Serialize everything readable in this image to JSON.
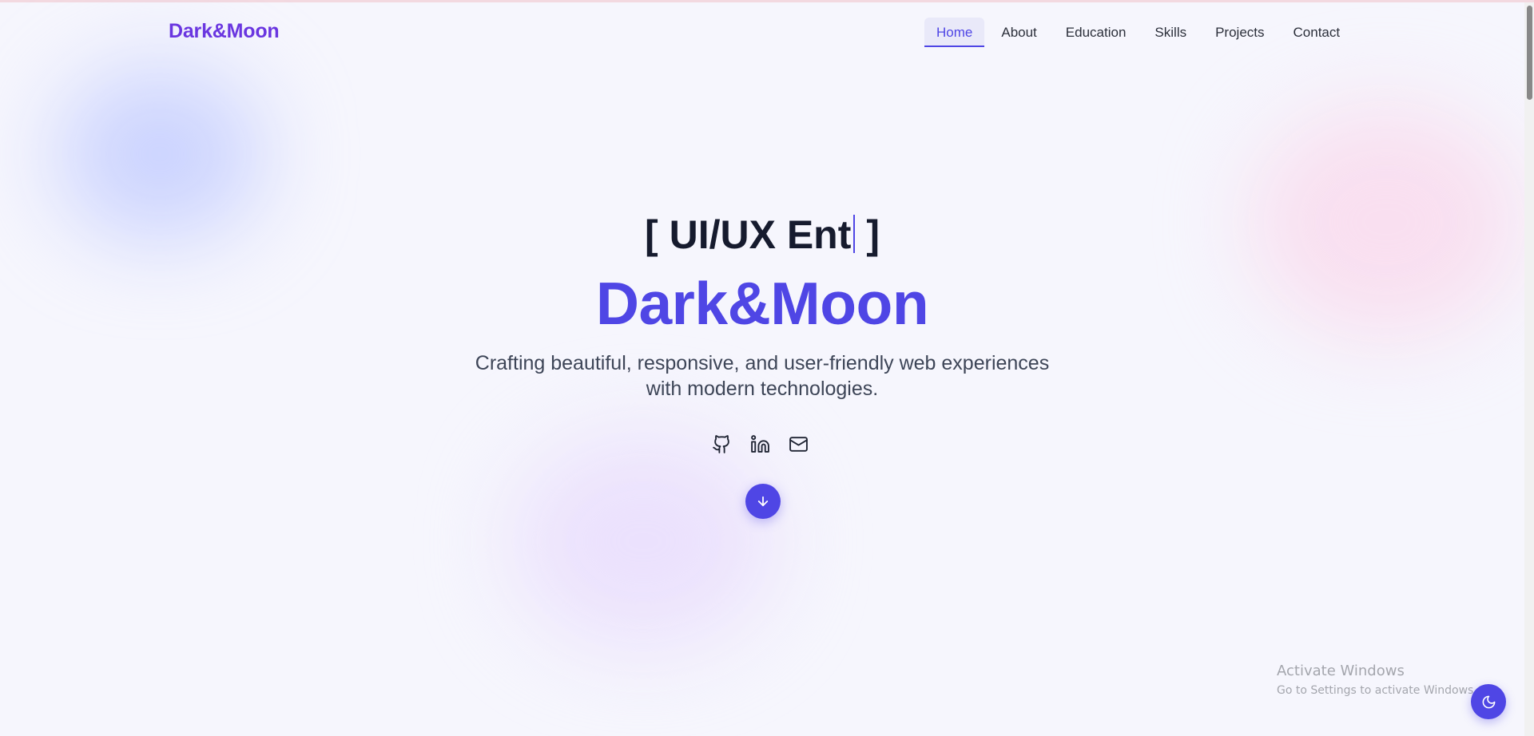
{
  "brand": {
    "name": "Dark&Moon"
  },
  "nav": {
    "items": [
      {
        "label": "Home",
        "active": true
      },
      {
        "label": "About"
      },
      {
        "label": "Education"
      },
      {
        "label": "Skills"
      },
      {
        "label": "Projects"
      },
      {
        "label": "Contact"
      }
    ]
  },
  "hero": {
    "bracket_open": "[",
    "typing_text": "UI/UX Ent",
    "bracket_close": "]",
    "name": "Dark&Moon",
    "tagline_line1": "Crafting beautiful, responsive, and user-friendly web experiences",
    "tagline_line2": "with modern technologies.",
    "socials": [
      {
        "icon": "github-icon"
      },
      {
        "icon": "linkedin-icon"
      },
      {
        "icon": "mail-icon"
      }
    ],
    "scroll_icon": "arrow-down-icon"
  },
  "overlay": {
    "watermark_title": "Activate Windows",
    "watermark_sub": "Go to Settings to activate Windows."
  },
  "theme_toggle": {
    "icon": "moon-icon"
  },
  "colors": {
    "accent": "#4f46e5",
    "brand": "#6a36e0",
    "heading": "#161b2e",
    "body_text": "#3d4557",
    "background": "#f6f6fd"
  }
}
